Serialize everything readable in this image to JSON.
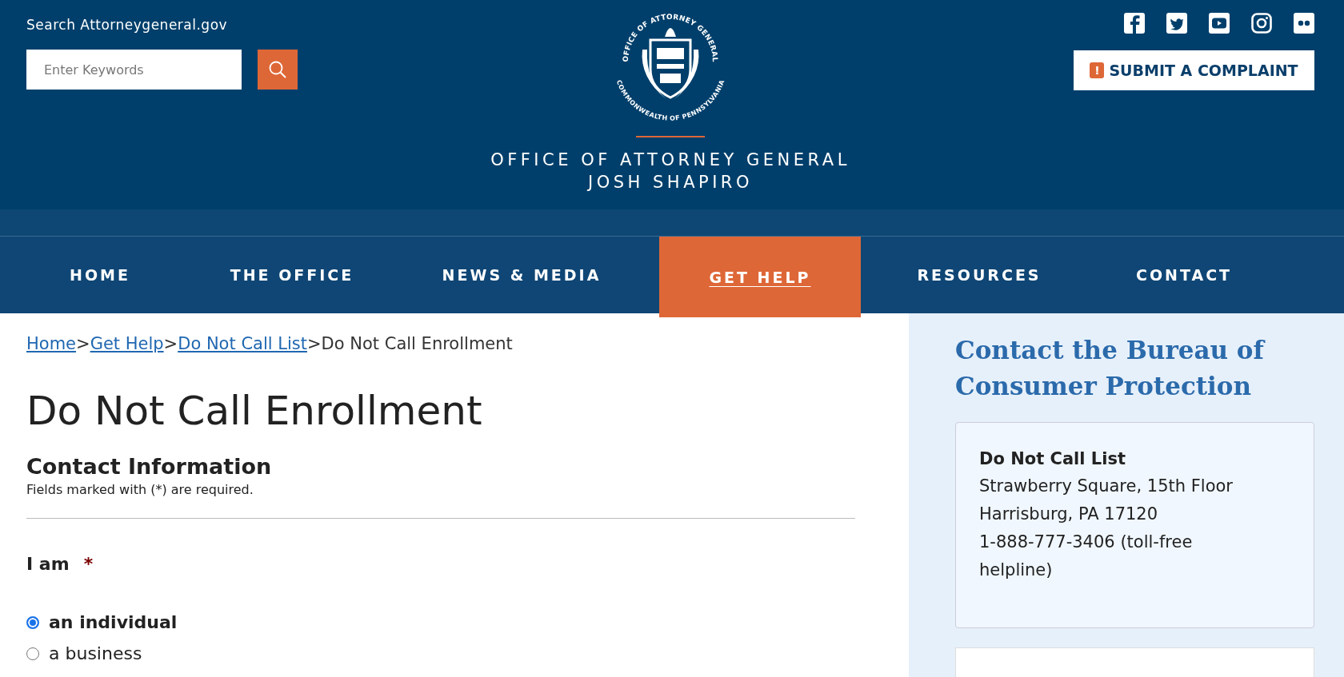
{
  "header": {
    "search_label": "Search Attorneygeneral.gov",
    "search": {
      "placeholder": "Enter Keywords"
    },
    "seal": {
      "top_text": "OFFICE OF ATTORNEY GENERAL",
      "bottom_text": "COMMONWEALTH OF PENNSYLVANIA"
    },
    "title_lines": [
      "OFFICE OF ATTORNEY GENERAL",
      "JOSH SHAPIRO"
    ],
    "complaint_button": {
      "label": "SUBMIT A COMPLAINT",
      "icon": "!"
    }
  },
  "nav": [
    {
      "label": "HOME",
      "selected": false
    },
    {
      "label": "THE OFFICE",
      "selected": false
    },
    {
      "label": "NEWS & MEDIA",
      "selected": false
    },
    {
      "label": "GET HELP",
      "selected": true
    },
    {
      "label": "RESOURCES",
      "selected": false
    },
    {
      "label": "CONTACT",
      "selected": false
    }
  ],
  "breadcrumb": [
    {
      "label": "Home",
      "kind": "link"
    },
    {
      "label": ">",
      "kind": "separator"
    },
    {
      "label": "Get Help",
      "kind": "link"
    },
    {
      "label": ">",
      "kind": "separator"
    },
    {
      "label": "Do Not Call List",
      "kind": "link"
    },
    {
      "label": ">",
      "kind": "separator"
    },
    {
      "label": "Do Not Call Enrollment",
      "kind": "current"
    }
  ],
  "page_title": "Do Not Call Enrollment",
  "section": {
    "heading": "Contact Information",
    "note": "Fields marked with (*) are required.",
    "field": {
      "label": "I am",
      "required_mark": "*",
      "options": [
        {
          "label": "an individual",
          "selected": true
        },
        {
          "label": "a business",
          "selected": false
        }
      ]
    }
  },
  "sidebar": {
    "heading": "Contact the Bureau of Consumer Protection",
    "card": {
      "title": "Do Not Call List",
      "lines": [
        "Strawberry Square, 15th Floor",
        "Harrisburg, PA 17120",
        "1-888-777-3406 (toll-free helpline)"
      ]
    }
  }
}
